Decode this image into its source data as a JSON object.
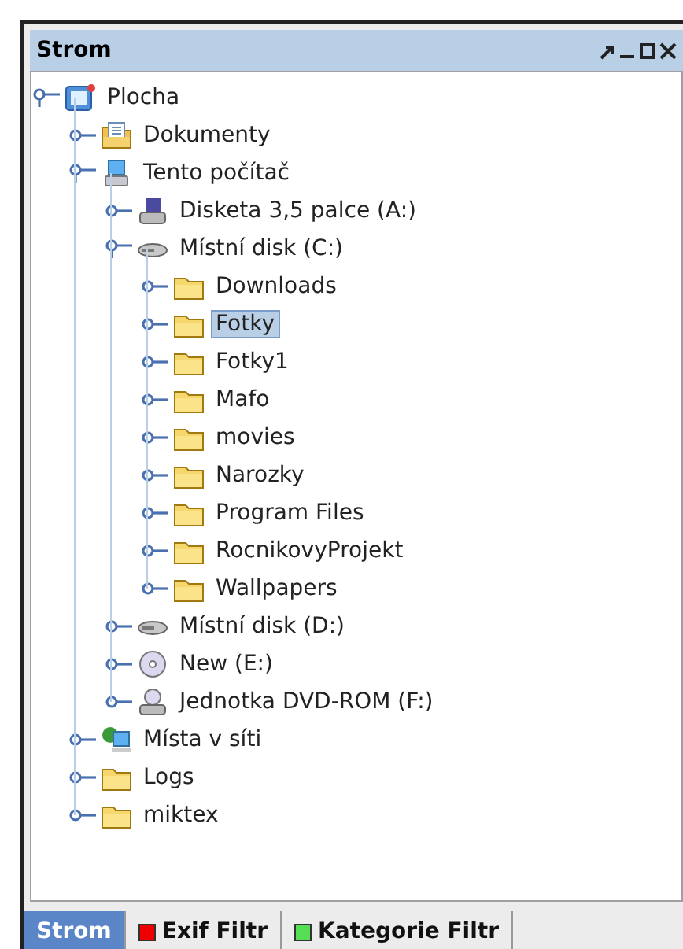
{
  "panel": {
    "title": "Strom"
  },
  "tree": [
    {
      "label": "Plocha",
      "kind": "desktop",
      "expanded": true,
      "selected": false,
      "children": [
        {
          "label": "Dokumenty",
          "kind": "documents",
          "expanded": false,
          "selected": false
        },
        {
          "label": "Tento počítač",
          "kind": "computer",
          "expanded": true,
          "selected": false,
          "children": [
            {
              "label": "Disketa 3,5 palce (A:)",
              "kind": "floppy",
              "expanded": false,
              "selected": false
            },
            {
              "label": "Místní disk (C:)",
              "kind": "disk",
              "expanded": true,
              "selected": false,
              "children": [
                {
                  "label": "Downloads",
                  "kind": "folder",
                  "expanded": false,
                  "selected": false
                },
                {
                  "label": "Fotky",
                  "kind": "folder",
                  "expanded": false,
                  "selected": true
                },
                {
                  "label": "Fotky1",
                  "kind": "folder",
                  "expanded": false,
                  "selected": false
                },
                {
                  "label": "Mafo",
                  "kind": "folder",
                  "expanded": false,
                  "selected": false
                },
                {
                  "label": "movies",
                  "kind": "folder",
                  "expanded": false,
                  "selected": false
                },
                {
                  "label": "Narozky",
                  "kind": "folder",
                  "expanded": false,
                  "selected": false
                },
                {
                  "label": "Program Files",
                  "kind": "folder",
                  "expanded": false,
                  "selected": false
                },
                {
                  "label": "RocnikovyProjekt",
                  "kind": "folder",
                  "expanded": false,
                  "selected": false
                },
                {
                  "label": "Wallpapers",
                  "kind": "folder",
                  "expanded": false,
                  "selected": false
                }
              ]
            },
            {
              "label": "Místní disk (D:)",
              "kind": "disk",
              "expanded": false,
              "selected": false
            },
            {
              "label": "New (E:)",
              "kind": "cd",
              "expanded": false,
              "selected": false
            },
            {
              "label": "Jednotka DVD-ROM (F:)",
              "kind": "dvd",
              "expanded": false,
              "selected": false
            }
          ]
        },
        {
          "label": "Místa v síti",
          "kind": "network",
          "expanded": false,
          "selected": false
        },
        {
          "label": "Logs",
          "kind": "folder",
          "expanded": false,
          "selected": false
        },
        {
          "label": "miktex",
          "kind": "folder",
          "expanded": false,
          "selected": false
        }
      ]
    }
  ],
  "tabs": [
    {
      "label": "Strom",
      "selected": true
    },
    {
      "label": "Exif Filtr",
      "selected": false,
      "color": "#ee0000"
    },
    {
      "label": "Kategorie Filtr",
      "selected": false,
      "color": "#55dd55"
    }
  ]
}
